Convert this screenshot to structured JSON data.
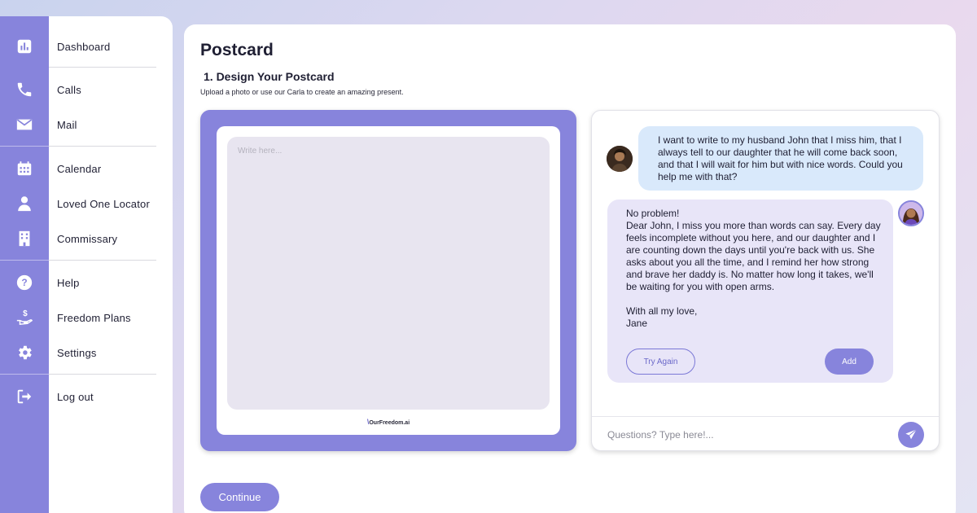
{
  "sidebar": {
    "items": [
      {
        "label": "Dashboard",
        "icon": "chart-icon"
      },
      {
        "label": "Calls",
        "icon": "phone-icon"
      },
      {
        "label": "Mail",
        "icon": "mail-icon"
      },
      {
        "label": "Calendar",
        "icon": "calendar-icon"
      },
      {
        "label": "Loved One Locator",
        "icon": "person-icon"
      },
      {
        "label": "Commissary",
        "icon": "building-icon"
      },
      {
        "label": "Help",
        "icon": "help-icon"
      },
      {
        "label": "Freedom Plans",
        "icon": "money-hand-icon"
      },
      {
        "label": "Settings",
        "icon": "gear-icon"
      },
      {
        "label": "Log out",
        "icon": "logout-icon"
      }
    ]
  },
  "main": {
    "title": "Postcard",
    "section_title": "1. Design Your Postcard",
    "section_subtitle": "Upload a photo or use our Carla to create an amazing present.",
    "postcard": {
      "placeholder": "Write here...",
      "brand": "OurFreedom.ai"
    },
    "chat": {
      "user_message": "I want to write to my husband John that I miss him, that I always tell to our daughter that he will come back soon, and that I will wait for him but with nice words. Could you help me with that?",
      "bot_message": "No problem!\nDear John, I miss you more than words can say. Every day feels incomplete without you here, and our daughter and I are counting down the days until you're back with us. She asks about you all the time, and I remind her how strong and brave her daddy is. No matter how long it takes, we'll be waiting for you with open arms.\n\nWith all my love,\nJane",
      "try_again_label": "Try Again",
      "add_label": "Add",
      "input_placeholder": "Questions? Type here!..."
    },
    "continue_label": "Continue"
  },
  "colors": {
    "accent": "#8784dc",
    "user_bubble": "#d9e9fb",
    "bot_bubble": "#e8e5f8",
    "write_area": "#e8e5f0"
  }
}
